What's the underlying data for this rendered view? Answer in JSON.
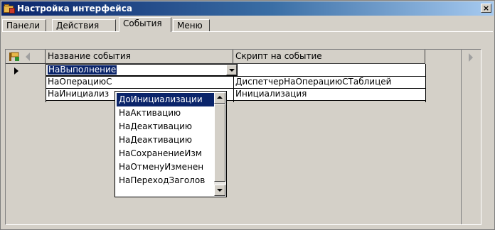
{
  "window": {
    "title": "Настройка интерфейса",
    "close_label": "×"
  },
  "tabs": [
    {
      "label": "Панели"
    },
    {
      "label": "Действия"
    },
    {
      "label": "События"
    },
    {
      "label": "Меню"
    }
  ],
  "active_tab": "События",
  "grid": {
    "columns": [
      {
        "label": "Название события"
      },
      {
        "label": "Скрипт на событие"
      }
    ],
    "rows": [
      {
        "event": "НаВыполнение",
        "script": ""
      },
      {
        "event": "НаОперациюС",
        "script": "ДиспетчерНаОперациюСТаблицей"
      },
      {
        "event": "НаИнициализ",
        "script": "Инициализация"
      }
    ]
  },
  "dropdown": {
    "selected_value": "НаВыполнение",
    "items": [
      {
        "label": "ДоИнициализации"
      },
      {
        "label": "НаАктивацию"
      },
      {
        "label": "НаДеактивацию"
      },
      {
        "label": "НаДеактивацию"
      },
      {
        "label": "НаСохранениеИзм"
      },
      {
        "label": "НаОтменуИзменен"
      },
      {
        "label": "НаПереходЗаголов"
      }
    ]
  },
  "colors": {
    "titlebar_start": "#0a246a",
    "titlebar_end": "#a6caf0",
    "selection": "#0a246a",
    "face": "#d4d0c8"
  }
}
